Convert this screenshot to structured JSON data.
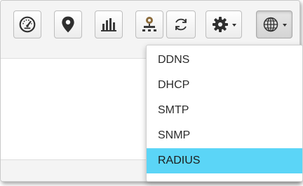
{
  "toolbar": {
    "buttons": [
      {
        "icon": "dashboard-icon"
      },
      {
        "icon": "location-pin-icon"
      },
      {
        "icon": "bar-chart-icon"
      },
      {
        "icon": "network-icon"
      },
      {
        "icon": "refresh-icon"
      },
      {
        "icon": "gear-icon",
        "has_dropdown": true
      },
      {
        "icon": "globe-icon",
        "has_dropdown": true,
        "active": true
      }
    ]
  },
  "dropdown": {
    "items": [
      {
        "label": "DDNS"
      },
      {
        "label": "DHCP"
      },
      {
        "label": "SMTP"
      },
      {
        "label": "SNMP"
      },
      {
        "label": "RADIUS",
        "highlighted": true
      }
    ]
  },
  "colors": {
    "highlight": "#5bd5f7",
    "icon": "#2f2f2f",
    "chart_bars": "#3a3a3a",
    "network_node": "#8a6a3a"
  }
}
